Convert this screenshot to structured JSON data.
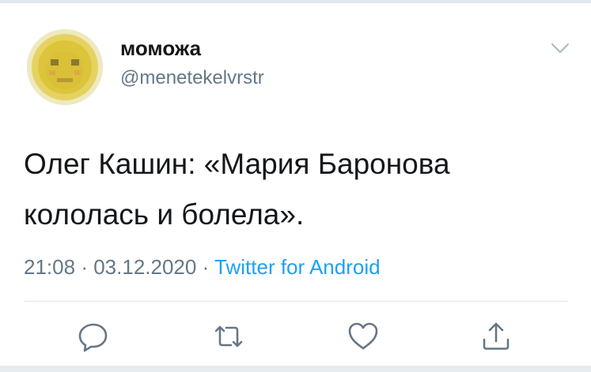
{
  "tweet": {
    "author": {
      "display_name": "моможа",
      "handle": "@menetekelvrstr",
      "avatar_icon": "yellow-face-avatar"
    },
    "text_line1": "Олег Кашин: «Мария Баронова",
    "text_line2": "кололась и болела».",
    "time": "21:08",
    "date": "03.12.2020",
    "separator": "·",
    "source": "Twitter for Android"
  },
  "actions": [
    {
      "name": "reply",
      "icon": "reply-icon"
    },
    {
      "name": "retweet",
      "icon": "retweet-icon"
    },
    {
      "name": "like",
      "icon": "heart-icon"
    },
    {
      "name": "share",
      "icon": "share-icon"
    }
  ],
  "colors": {
    "text": "#14171a",
    "secondary": "#657786",
    "link": "#1da1f2",
    "border": "#e1e8ed"
  }
}
